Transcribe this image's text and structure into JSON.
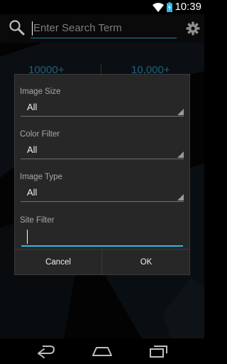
{
  "status_bar": {
    "time": "10:39"
  },
  "search": {
    "placeholder": "Enter Search Term"
  },
  "background_stats": {
    "left": "10000+",
    "right": "10,000+"
  },
  "dialog": {
    "fields": [
      {
        "label": "Image Size",
        "value": "All"
      },
      {
        "label": "Color Filter",
        "value": "All"
      },
      {
        "label": "Image Type",
        "value": "All"
      }
    ],
    "site_filter": {
      "label": "Site Filter",
      "value": ""
    },
    "cancel_label": "Cancel",
    "ok_label": "OK"
  },
  "colors": {
    "accent": "#33b5e5",
    "dialog_bg": "#272727"
  },
  "icons": [
    "wifi-icon",
    "battery-icon",
    "search-icon",
    "gear-icon",
    "back-icon",
    "home-icon",
    "recents-icon"
  ]
}
